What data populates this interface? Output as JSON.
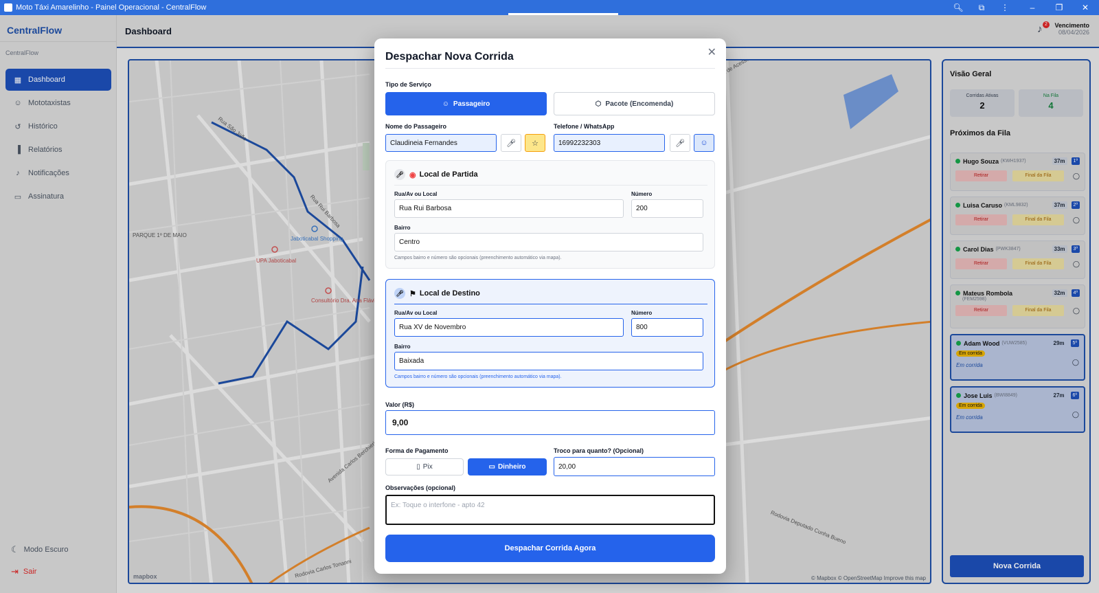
{
  "window": {
    "title": "Moto Táxi Amarelinho - Painel Operacional - CentralFlow"
  },
  "sidebar": {
    "brand": "CentralFlow",
    "brand_sub": "CentralFlow",
    "items": [
      {
        "label": "Dashboard",
        "icon": "grid-icon",
        "active": true
      },
      {
        "label": "Mototaxistas",
        "icon": "users-icon"
      },
      {
        "label": "Histórico",
        "icon": "history-icon"
      },
      {
        "label": "Relatórios",
        "icon": "bar-chart-icon"
      },
      {
        "label": "Notificações",
        "icon": "bell-icon"
      },
      {
        "label": "Assinatura",
        "icon": "card-icon"
      }
    ],
    "dark_mode": "Modo Escuro",
    "logout": "Sair"
  },
  "header": {
    "title": "Dashboard",
    "bell_badge": "2",
    "venc_label": "Vencimento",
    "venc_date": "08/04/2026"
  },
  "map": {
    "attribution": "© Mapbox © OpenStreetMap  Improve this map",
    "logo": "mapbox",
    "labels": {
      "parque": "PARQUE 1º DE MAIO",
      "upa": "UPA Jaboticabal",
      "shopping": "Jaboticabal Shopping",
      "hospital": "Consultório Dra. Ana Flávia Paia",
      "rua_sao_joao": "Rua São João",
      "rua_rui": "Rua Rui Barbosa",
      "av_carlos": "Avenida Carlos Berchieri",
      "rod_carlos": "Rodovia Carlos Tonanni",
      "rod_dep": "Rodovia Deputado Cunha Bueno",
      "via_acesso": "Via de Acesso"
    }
  },
  "right_panel": {
    "title": "Visão Geral",
    "active_label": "Corridas Ativas",
    "active_value": "2",
    "queue_label": "Na Fila",
    "queue_value": "4",
    "next_title": "Próximos da Fila",
    "queue": [
      {
        "name": "Hugo Souza",
        "plate": "(KWH1937)",
        "time": "37m",
        "pos": "1º",
        "busy": false
      },
      {
        "name": "Luisa Caruso",
        "plate": "(KML9832)",
        "time": "37m",
        "pos": "2º",
        "busy": false
      },
      {
        "name": "Carol Dias",
        "plate": "(PWK3847)",
        "time": "33m",
        "pos": "3º",
        "busy": false
      },
      {
        "name": "Mateus Rombola",
        "plate": "(FEM2598)",
        "time": "32m",
        "pos": "4º",
        "busy": false
      },
      {
        "name": "Adam Wood",
        "plate": "(VUW2585)",
        "time": "29m",
        "pos": "5º",
        "busy": true
      },
      {
        "name": "Jose Luis",
        "plate": "(BWI8849)",
        "time": "27m",
        "pos": "6º",
        "busy": true
      }
    ],
    "retirar": "Retirar",
    "final": "Final da Fila",
    "status_busy": "Em corrida",
    "busy_text": "Em corrida",
    "new_ride": "Nova Corrida"
  },
  "modal": {
    "title": "Despachar Nova Corrida",
    "service_label": "Tipo de Serviço",
    "service_passenger": "Passageiro",
    "service_package": "Pacote (Encomenda)",
    "name_label": "Nome do Passageiro",
    "name_value": "Claudineia Fernandes",
    "phone_label": "Telefone / WhatsApp",
    "phone_value": "16992232303",
    "origin": {
      "title": "Local de Partida",
      "street_label": "Rua/Av ou Local",
      "street_value": "Rua Rui Barbosa",
      "number_label": "Número",
      "number_value": "200",
      "district_label": "Bairro",
      "district_value": "Centro",
      "hint": "Campos bairro e número são opcionais (preenchimento automático via mapa)."
    },
    "destination": {
      "title": "Local de Destino",
      "street_label": "Rua/Av ou Local",
      "street_value": "Rua XV de Novembro",
      "number_label": "Número",
      "number_value": "800",
      "district_label": "Bairro",
      "district_value": "Baixada",
      "hint": "Campos bairro e número são opcionais (preenchimento automático via mapa)."
    },
    "value_label": "Valor (R$)",
    "value": "9,00",
    "payment_label": "Forma de Pagamento",
    "pay_pix": "Pix",
    "pay_cash": "Dinheiro",
    "change_label": "Troco para quanto? (Opcional)",
    "change_value": "20,00",
    "notes_label": "Observações (opcional)",
    "notes_placeholder": "Ex: Toque o interfone - apto 42",
    "submit": "Despachar Corrida Agora"
  }
}
